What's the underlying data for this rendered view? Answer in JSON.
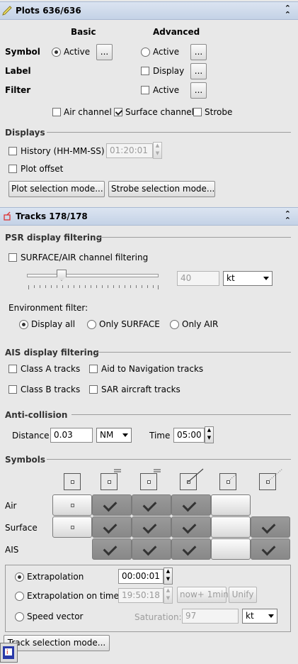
{
  "plots": {
    "title": "Plots  636/636",
    "collapse_glyph": "⌃",
    "col_basic": "Basic",
    "col_advanced": "Advanced",
    "rows": {
      "symbol": "Symbol",
      "label": "Label",
      "filter": "Filter"
    },
    "basic_symbol_active": "Active",
    "adv_symbol_active": "Active",
    "adv_label_display": "Display",
    "adv_filter_active": "Active",
    "ellipsis": "...",
    "channels": {
      "air": "Air channel",
      "surface": "Surface channel",
      "strobe": "Strobe"
    },
    "displays_title": "Displays",
    "history_label": "History (HH-MM-SS)",
    "history_value": "01:20:01",
    "plot_offset_label": "Plot offset",
    "plot_selection_button": "Plot selection mode...",
    "strobe_selection_button": "Strobe selection mode..."
  },
  "tracks": {
    "title": "Tracks  178/178",
    "psr_title": "PSR display filtering",
    "surface_air_filter_label": "SURFACE/AIR channel filtering",
    "speed_value": "40",
    "speed_unit": "kt",
    "environment_filter_label": "Environment filter:",
    "env_display_all": "Display all",
    "env_only_surface": "Only SURFACE",
    "env_only_air": "Only AIR",
    "ais_title": "AIS display filtering",
    "class_a": "Class A tracks",
    "aid_nav": "Aid to Navigation tracks",
    "class_b": "Class B tracks",
    "sar_aircraft": "SAR aircraft tracks",
    "anticollision_title": "Anti-collision",
    "distance_label": "Distance",
    "distance_value": "0.03",
    "distance_unit": "NM",
    "time_label": "Time",
    "time_value": "05:00",
    "symbols_title": "Symbols",
    "grid_rows": [
      {
        "label": "Air",
        "cells": [
          "dot",
          "on",
          "on",
          "on",
          "off",
          "none"
        ]
      },
      {
        "label": "Surface",
        "cells": [
          "dot",
          "on",
          "on",
          "on",
          "off",
          "on"
        ]
      },
      {
        "label": "AIS",
        "cells": [
          "none",
          "on",
          "on",
          "on",
          "off",
          "on"
        ]
      }
    ],
    "extrapolation_label": "Extrapolation",
    "extrapolation_value": "00:00:01",
    "extrapolation_on_time_label": "Extrapolation on time",
    "extrapolation_on_time_value": "19:50:18",
    "now_plus_button": "now+ 1min",
    "unify_button": "Unify",
    "speed_vector_label": "Speed vector",
    "saturation_label": "Saturation:",
    "saturation_value": "97",
    "saturation_unit": "kt",
    "track_selection_button": "Track selection mode..."
  },
  "colors": {
    "header_bg": "#c4d2e6",
    "panel_bg": "#e8e8e8",
    "grid_on": "#8f8f8f"
  }
}
